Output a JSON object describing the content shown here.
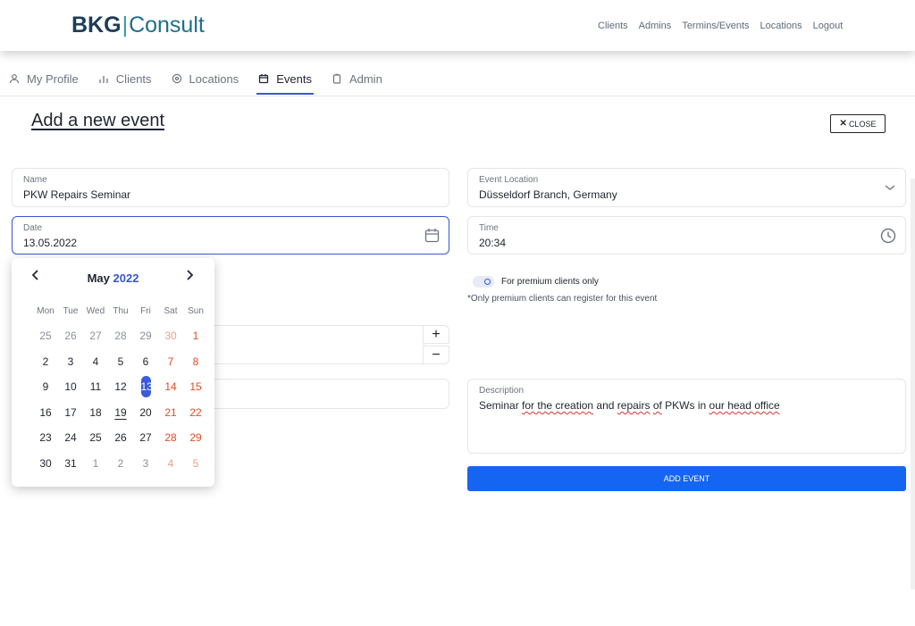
{
  "header": {
    "logo_bkg": "BKG",
    "logo_sep": "|",
    "logo_consult": "Consult",
    "nav": [
      "Clients",
      "Admins",
      "Termins/Events",
      "Locations",
      "Logout"
    ]
  },
  "tabs": [
    {
      "label": "My Profile",
      "icon": "user-icon"
    },
    {
      "label": "Clients",
      "icon": "bar-chart-icon"
    },
    {
      "label": "Locations",
      "icon": "map-pin-icon"
    },
    {
      "label": "Events",
      "icon": "calendar-icon",
      "active": true
    },
    {
      "label": "Admin",
      "icon": "clipboard-icon"
    }
  ],
  "page": {
    "title": "Add a new event",
    "close_label": "CLOSE"
  },
  "form": {
    "name": {
      "label": "Name",
      "value": "PKW Repairs Seminar"
    },
    "location": {
      "label": "Event Location",
      "value": "Düsseldorf Branch, Germany"
    },
    "date": {
      "label": "Date",
      "value": "13.05.2022"
    },
    "time": {
      "label": "Time",
      "value": "20:34"
    },
    "premium": {
      "label": "For premium clients only",
      "note": "*Only premium clients can register for this event"
    },
    "stepper": {
      "plus": "+",
      "minus": "−"
    },
    "description": {
      "label": "Description",
      "parts": [
        "Seminar ",
        "for the creation",
        " and ",
        "repairs",
        " ",
        "of",
        " PKWs in ",
        "our head office"
      ]
    },
    "submit_label": "ADD EVENT"
  },
  "calendar": {
    "month": "May",
    "year": "2022",
    "prev": "‹",
    "next": "›",
    "weekdays": [
      "Mon",
      "Tue",
      "Wed",
      "Thu",
      "Fri",
      "Sat",
      "Sun"
    ],
    "weeks": [
      [
        "25",
        "26",
        "27",
        "28",
        "29",
        "30",
        "1"
      ],
      [
        "2",
        "3",
        "4",
        "5",
        "6",
        "7",
        "8"
      ],
      [
        "9",
        "10",
        "11",
        "12",
        "13",
        "14",
        "15"
      ],
      [
        "16",
        "17",
        "18",
        "19",
        "20",
        "21",
        "22"
      ],
      [
        "23",
        "24",
        "25",
        "26",
        "27",
        "28",
        "29"
      ],
      [
        "30",
        "31",
        "1",
        "2",
        "3",
        "4",
        "5"
      ]
    ],
    "selected": "13",
    "today": "19"
  },
  "colors": {
    "accent": "#3a56d4",
    "button": "#1565f3",
    "weekend": "#e04b2a"
  }
}
